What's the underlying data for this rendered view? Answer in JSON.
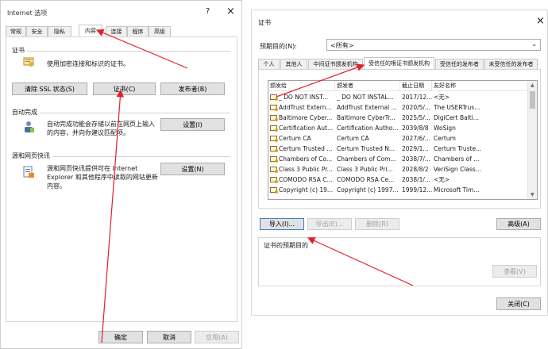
{
  "left_dialog": {
    "title": "Internet 选项",
    "help_icon": "?",
    "close_icon": "×",
    "tabs": [
      "常规",
      "安全",
      "隐私",
      "内容",
      "连接",
      "程序",
      "高级"
    ],
    "cert_group": {
      "title": "证书",
      "desc": "使用加密连接和标识的证书。",
      "btn_clear_ssl": "清除 SSL 状态(S)",
      "btn_certs": "证书(C)",
      "btn_publishers": "发布者(B)"
    },
    "autocomplete_group": {
      "title": "自动完成",
      "desc": "自动完成功能会存储以前在网页上输入的内容，并向你建议匹配项。",
      "btn_settings": "设置(I)"
    },
    "feeds_group": {
      "title": "源和网页快讯",
      "desc": "源和网页快讯提供可在 Internet Explorer 和其他程序中读取的网站更新内容。",
      "btn_settings": "设置(N)"
    },
    "footer": {
      "ok": "确定",
      "cancel": "取消",
      "apply": "应用(A)"
    }
  },
  "right_dialog": {
    "title": "证书",
    "close_icon": "×",
    "purpose_label": "预期目的(N):",
    "purpose_value": "<所有>",
    "tabs": [
      "个人",
      "其他人",
      "中间证书颁发机构",
      "受信任的根证书颁发机构",
      "受信任的发布者",
      "未受信任的发布者"
    ],
    "columns": [
      "颁发给",
      "颁发者",
      "截止日期",
      "友好名称"
    ],
    "rows": [
      [
        "_ DO NOT INST...",
        "_ DO NOT INSTAL...",
        "2017/12...",
        "<无>"
      ],
      [
        "AddTrust Extern...",
        "AddTrust External ...",
        "2020/5/...",
        "The USERTrus..."
      ],
      [
        "Baltimore Cyber...",
        "Baltimore CyberTr...",
        "2025/5/...",
        "DigiCert Balti..."
      ],
      [
        "Certification Aut...",
        "Certification Autho...",
        "2039/8/8",
        "WoSign"
      ],
      [
        "Certum CA",
        "Certum CA",
        "2027/6/...",
        "Certum"
      ],
      [
        "Certum Trusted ...",
        "Certum Trusted N...",
        "2029/1...",
        "Certum Truste..."
      ],
      [
        "Chambers of Co...",
        "Chambers of Com...",
        "2038/7/...",
        "Chambers of ..."
      ],
      [
        "Class 3 Public Pr...",
        "Class 3 Public Pri...",
        "2028/8/2",
        "VeriSign Class..."
      ],
      [
        "COMODO RSA C...",
        "COMODO RSA Ce...",
        "2038/1/...",
        "<无>"
      ],
      [
        "Copyright (c) 19...",
        "Copyright (c) 1997...",
        "1999/12...",
        "Microsoft Tim..."
      ]
    ],
    "btn_import": "导入(I)...",
    "btn_export": "导出(E)...",
    "btn_remove": "删除(R)",
    "btn_advanced": "高级(A)",
    "purposes_title": "证书的预期目的",
    "btn_view": "查看(V)",
    "btn_close": "关闭(C)"
  },
  "colors": {
    "annotation_arrow": "#e0202a"
  }
}
